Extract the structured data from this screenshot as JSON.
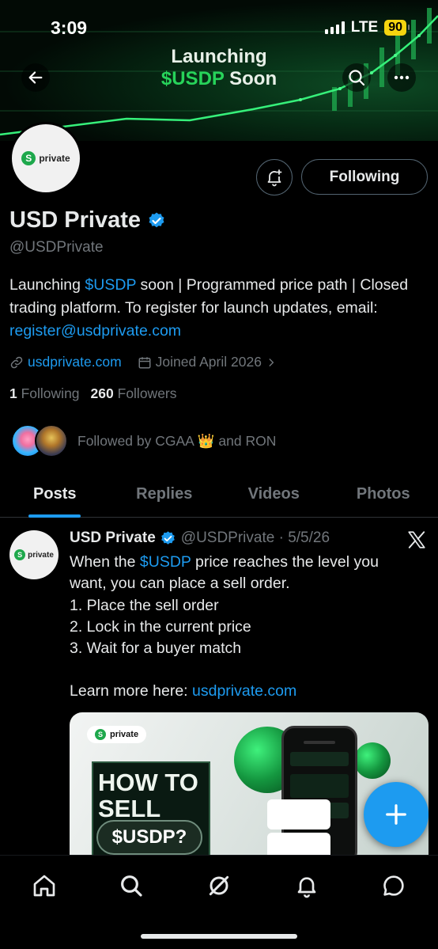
{
  "status_bar": {
    "time": "3:09",
    "network": "LTE",
    "battery": "90"
  },
  "banner": {
    "line1": "Launching",
    "line2_accent": "$USDP",
    "line2_rest": " Soon"
  },
  "profile": {
    "avatar_text": "private",
    "logo_letter": "S",
    "follow_button": "Following",
    "name": "USD Private",
    "handle": "@USDPrivate",
    "bio": {
      "part1": "Launching ",
      "cashtag": "$USDP",
      "part2": " soon | Programmed price path | Closed trading platform. To register for launch updates, email: ",
      "email": "register@usdprivate.com"
    },
    "website": "usdprivate.com",
    "joined": "Joined April 2026",
    "following_count": "1",
    "following_label": "Following",
    "followers_count": "260",
    "followers_label": "Followers",
    "followed_by": "Followed by CGAA 👑 and RON"
  },
  "tabs": [
    {
      "label": "Posts",
      "active": true
    },
    {
      "label": "Replies",
      "active": false
    },
    {
      "label": "Videos",
      "active": false
    },
    {
      "label": "Photos",
      "active": false
    }
  ],
  "post": {
    "avatar_text": "private",
    "author": "USD Private",
    "handle_date": "@USDPrivate · 5/5/26",
    "text": {
      "l1a": "When the ",
      "l1tag": "$USDP",
      "l1b": " price reaches the level you want, you can place a sell order.",
      "l2": "1. Place the sell order",
      "l3": "2. Lock in the current price",
      "l4": "3. Wait for a buyer match",
      "l5a": "Learn more here: ",
      "l5link": "usdprivate.com"
    },
    "media": {
      "logo_text": "private",
      "headline_1": "HOW TO",
      "headline_2": "SELL",
      "pill": "$USDP?"
    }
  },
  "colors": {
    "accent": "#1d9bf0",
    "brand_green": "#1ea84c",
    "banner_green": "#27d35a"
  },
  "bottom_nav": [
    "home-icon",
    "search-icon",
    "grok-icon",
    "notifications-icon",
    "messages-icon"
  ]
}
